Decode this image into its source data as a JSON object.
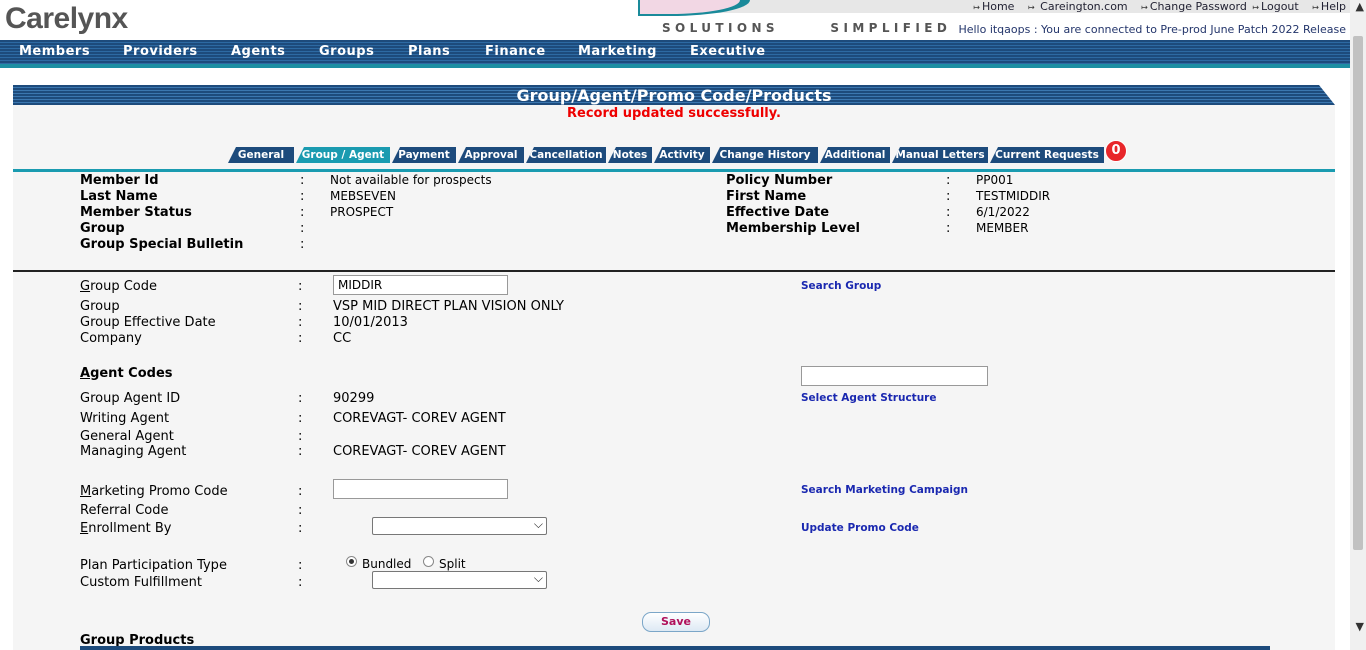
{
  "header": {
    "logo": "Carelynx",
    "tagline": "SOLUTIONS   SIMPLIFIED",
    "links": [
      "Home",
      "Careington.com",
      "Change Password",
      "Logout",
      "Help"
    ],
    "hello": "Hello itqaops : You are connected to Pre-prod June Patch 2022 Release"
  },
  "nav": [
    "Members",
    "Providers",
    "Agents",
    "Groups",
    "Plans",
    "Finance",
    "Marketing",
    "Executive"
  ],
  "page": {
    "title": "Group/Agent/Promo Code/Products",
    "message": "Record updated successfully.",
    "badge": "0"
  },
  "tabs": [
    "General",
    "Group / Agent",
    "Payment",
    "Approval",
    "Cancellation",
    "Notes",
    "Activity",
    "Change History",
    "Additional",
    "Manual Letters",
    "Current Requests"
  ],
  "member": {
    "member_id_label": "Member Id",
    "member_id": "Not available for prospects",
    "last_name_label": "Last Name",
    "last_name": "MEBSEVEN",
    "status_label": "Member Status",
    "status": "PROSPECT",
    "group_label": "Group",
    "group": "",
    "bulletin_label": "Group Special Bulletin",
    "bulletin": "",
    "policy_label": "Policy Number",
    "policy": "PP001",
    "first_name_label": "First Name",
    "first_name": "TESTMIDDIR",
    "effective_label": "Effective Date",
    "effective": "6/1/2022",
    "level_label": "Membership Level",
    "level": "MEMBER",
    "colon": ":"
  },
  "group": {
    "code_label": "Group Code",
    "code_underline": "G",
    "code_rest": "roup Code",
    "code_value": "MIDDIR",
    "search_group": "Search Group",
    "group_label": "Group",
    "group_value": "VSP MID DIRECT PLAN VISION ONLY",
    "effective_label": "Group Effective Date",
    "effective_value": "10/01/2013",
    "company_label": "Company",
    "company_value": "CC"
  },
  "agent": {
    "heading": "Agent Codes",
    "heading_underline": "A",
    "heading_rest": "gent Codes",
    "search_value": "",
    "group_agent_label": "Group Agent ID",
    "group_agent_value": "90299",
    "select_structure": "Select Agent Structure",
    "writing_label": "Writing Agent",
    "writing_value": "COREVAGT- COREV AGENT",
    "general_label": "General Agent",
    "general_value": "",
    "managing_label": "Managing Agent",
    "managing_value": "COREVAGT- COREV AGENT"
  },
  "promo": {
    "label_underline": "M",
    "label_rest": "arketing Promo Code",
    "value": "",
    "search_campaign": "Search Marketing Campaign",
    "referral_label": "Referral Code",
    "enroll_underline": "E",
    "enroll_rest": "nrollment By",
    "enroll_value": "",
    "update_promo": "Update Promo Code"
  },
  "plan": {
    "participation_label": "Plan Participation Type",
    "bundled": "Bundled",
    "split": "Split",
    "selected": "Bundled",
    "fulfillment_label": "Custom Fulfillment",
    "fulfillment_value": ""
  },
  "save_label": "Save",
  "products_heading": "Group Products",
  "colors": {
    "navy": "#1d4b7c",
    "teal": "#1a9bb0",
    "error": "#e00000",
    "link": "#1a28b0"
  }
}
